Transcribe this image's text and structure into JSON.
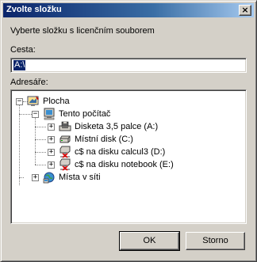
{
  "dialog": {
    "title": "Zvolte složku",
    "close_glyph": "×",
    "instruction": "Vyberte složku s licenčním souborem",
    "path_label": "Cesta:",
    "path_value": "A:\\",
    "folders_label": "Adresáře:"
  },
  "tree": {
    "desktop": {
      "label": "Plocha",
      "expander": "−",
      "icon": "desktop-icon"
    },
    "my_computer": {
      "label": "Tento počítač",
      "expander": "−",
      "icon": "computer-icon"
    },
    "drives": [
      {
        "label": "Disketa 3,5 palce (A:)",
        "expander": "+",
        "icon": "floppy-drive-icon"
      },
      {
        "label": "Místní disk (C:)",
        "expander": "+",
        "icon": "hard-drive-icon"
      },
      {
        "label": "c$ na disku calcul3 (D:)",
        "expander": "+",
        "icon": "network-drive-icon"
      },
      {
        "label": "c$ na disku notebook (E:)",
        "expander": "+",
        "icon": "network-drive-icon"
      }
    ],
    "network": {
      "label": "Místa v síti",
      "expander": "+",
      "icon": "network-places-icon"
    }
  },
  "buttons": {
    "ok": "OK",
    "cancel": "Storno"
  },
  "colors": {
    "face": "#d4d0c8",
    "title_start": "#0a246a",
    "title_end": "#a6caf0",
    "selection": "#0a246a"
  }
}
